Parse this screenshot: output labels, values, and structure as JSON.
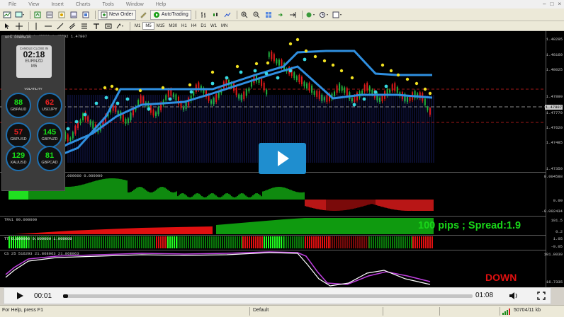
{
  "menubar": {
    "items": [
      "File",
      "View",
      "Insert",
      "Charts",
      "Tools",
      "Window",
      "Help"
    ]
  },
  "toolbar": {
    "new_order_label": "New Order",
    "autotrading_label": "AutoTrading",
    "timeframes": [
      "M1",
      "M5",
      "M15",
      "M30",
      "H1",
      "H4",
      "D1",
      "W1",
      "MN"
    ]
  },
  "chart": {
    "header_text": "EURNZD,M5  1.47832 1.47792 1.47807",
    "symbol_overlay": "UPS DOWNWIN",
    "price_axis_labels": [
      "1.48295",
      "1.48160",
      "1.48025",
      "1.47890",
      "1.47807",
      "1.47770",
      "1.47620",
      "1.47485",
      "1.47350"
    ],
    "current_price": "1.47807",
    "panes": [
      {
        "label": "TRWave 0.000000  0.001758 0.000000 0.000000",
        "axis": [
          "0.004588",
          "0.00",
          "-0.002434"
        ]
      },
      {
        "label": "TRV1 99.000000",
        "axis": [
          "101.5",
          "0.2"
        ]
      },
      {
        "label": "TT 0.000000 0.000000 1.000000",
        "axis": [
          "1.05",
          "-0.05"
        ]
      },
      {
        "label": "CS 25 516293 21.868063 21.868063",
        "axis": [
          "101.8030",
          "16.7335"
        ]
      }
    ],
    "colors": {
      "up_candle": "#1fb23e",
      "down_candle": "#e01a1a",
      "band": "#2f8fe0",
      "dots_yellow": "#f0e020",
      "dots_cyan": "#36d8e0",
      "bull_histo": "#0f8a0f",
      "bear_histo": "#b81616"
    }
  },
  "dashboard": {
    "candle_label": "CANDLE CLOSE IN",
    "countdown": "02:18",
    "symbol": "EURNZD",
    "timeframe": "M5",
    "volatility_label": "VOLATILITY",
    "gauges": [
      {
        "value": "88",
        "name": "GBPAUD",
        "color": "#19e019"
      },
      {
        "value": "62",
        "name": "USDJPY",
        "color": "#e82020"
      },
      {
        "value": "57",
        "name": "GBPUSD",
        "color": "#e82020"
      },
      {
        "value": "145",
        "name": "GBPNZD",
        "color": "#19e019"
      },
      {
        "value": "129",
        "name": "XAUUSD",
        "color": "#19e019"
      },
      {
        "value": "81",
        "name": "GBPCAD",
        "color": "#19e019"
      }
    ]
  },
  "overlays": {
    "pips_text": "100 pips ; Spread:1.9",
    "signal_text": "DOWN"
  },
  "video": {
    "current_time": "00:01",
    "total_time": "01:08",
    "progress": 0.012
  },
  "status": {
    "help_text": "For Help, press F1",
    "profile": "Default",
    "traffic": "50704/11 kb"
  }
}
